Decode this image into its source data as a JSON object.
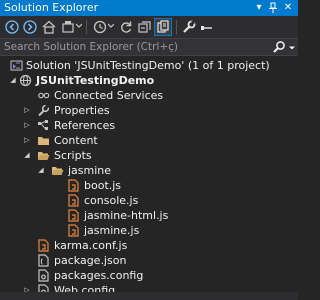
{
  "window": {
    "title": "Solution Explorer",
    "controls": {
      "dropdown": "▾",
      "pin": "↕",
      "close": "✕"
    }
  },
  "toolbar": {
    "buttons": [
      "back-icon",
      "forward-icon",
      "home-icon",
      "solution-view-icon",
      "pending-changes-icon",
      "refresh-icon",
      "collapse-all-icon",
      "show-all-files-icon",
      "properties-icon",
      "preview-icon"
    ]
  },
  "search": {
    "placeholder": "Search Solution Explorer (Ctrl+ç)"
  },
  "tree": {
    "solution": "Solution 'JSUnitTestingDemo' (1 of 1 project)",
    "project": "JSUnitTestingDemo",
    "connected_services": "Connected Services",
    "properties": "Properties",
    "references": "References",
    "content": "Content",
    "scripts": "Scripts",
    "jasmine": "jasmine",
    "boot": "boot.js",
    "console": "console.js",
    "jasmine_html": "jasmine-html.js",
    "jasmine_js": "jasmine.js",
    "karma": "karma.conf.js",
    "package_json": "package.json",
    "packages_config": "packages.config",
    "web_config": "Web.config"
  },
  "colors": {
    "accent": "#007acc",
    "background": "#252526",
    "toolbar": "#2d2d30",
    "folder": "#dcb67a",
    "js_file": "#e8853f",
    "project": "#68217a"
  }
}
